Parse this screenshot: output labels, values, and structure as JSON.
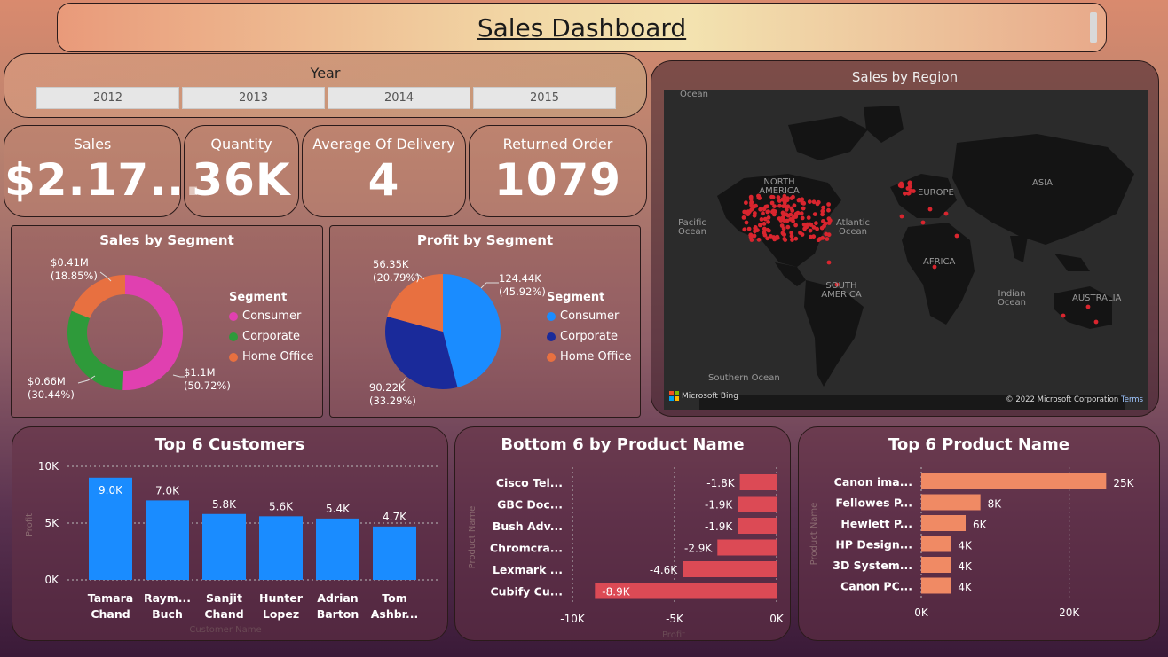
{
  "header": {
    "title": "Sales Dashboard"
  },
  "year_slicer": {
    "label": "Year",
    "options": [
      "2012",
      "2013",
      "2014",
      "2015"
    ]
  },
  "kpis": [
    {
      "label": "Sales",
      "value": "$2.17..."
    },
    {
      "label": "Quantity",
      "value": "36K"
    },
    {
      "label": "Average Of Delivery",
      "value": "4"
    },
    {
      "label": "Returned Order",
      "value": "1079"
    }
  ],
  "sales_by_segment": {
    "title": "Sales by Segment",
    "legend_title": "Segment",
    "legend": [
      "Consumer",
      "Corporate",
      "Home Office"
    ],
    "labels": {
      "home_office": [
        "$0.41M",
        "(18.85%)"
      ],
      "corporate": [
        "$0.66M",
        "(30.44%)"
      ],
      "consumer": [
        "$1.1M",
        "(50.72%)"
      ]
    }
  },
  "profit_by_segment": {
    "title": "Profit by Segment",
    "legend_title": "Segment",
    "legend": [
      "Consumer",
      "Corporate",
      "Home Office"
    ],
    "labels": {
      "home_office": [
        "56.35K",
        "(20.79%)"
      ],
      "consumer": [
        "124.44K",
        "(45.92%)"
      ],
      "corporate": [
        "90.22K",
        "(33.29%)"
      ]
    }
  },
  "map": {
    "title": "Sales by Region",
    "labels": [
      "Ocean",
      "NORTH AMERICA",
      "EUROPE",
      "ASIA",
      "Pacific Ocean",
      "Atlantic Ocean",
      "AFRICA",
      "SOUTH AMERICA",
      "Indian Ocean",
      "AUSTRALIA",
      "Southern Ocean"
    ],
    "bing": "Microsoft Bing",
    "copyright": "© 2022 Microsoft Corporation",
    "terms": "Terms"
  },
  "colors": {
    "consumer_sales": "#e040b0",
    "corporate_sales": "#2e9a3a",
    "home_office": "#e87040",
    "consumer_profit": "#1a8cff",
    "corporate_profit": "#1a2a9a",
    "bar_blue": "#1a8cff",
    "bar_red": "#dc4a55",
    "bar_orange": "#f08a64"
  },
  "chart_data": [
    {
      "type": "pie",
      "title": "Sales by Segment",
      "categories": [
        "Consumer",
        "Corporate",
        "Home Office"
      ],
      "values": [
        1.1,
        0.66,
        0.41
      ],
      "percent": [
        50.72,
        30.44,
        18.85
      ],
      "unit": "$M"
    },
    {
      "type": "pie",
      "title": "Profit by Segment",
      "categories": [
        "Consumer",
        "Corporate",
        "Home Office"
      ],
      "values": [
        124.44,
        90.22,
        56.35
      ],
      "percent": [
        45.92,
        33.29,
        20.79
      ],
      "unit": "K"
    },
    {
      "type": "bar",
      "title": "Top 6 Customers",
      "categories": [
        [
          "Tamara",
          "Chand"
        ],
        [
          "Raym...",
          "Buch"
        ],
        [
          "Sanjit",
          "Chand"
        ],
        [
          "Hunter",
          "Lopez"
        ],
        [
          "Adrian",
          "Barton"
        ],
        [
          "Tom",
          "Ashbr..."
        ]
      ],
      "values": [
        9.0,
        7.0,
        5.8,
        5.6,
        5.4,
        4.7
      ],
      "data_labels": [
        "9.0K",
        "7.0K",
        "5.8K",
        "5.6K",
        "5.4K",
        "4.7K"
      ],
      "yticks": [
        "10K",
        "5K",
        "0K"
      ],
      "ylim": [
        0,
        10
      ],
      "ylabel": "Profit",
      "xlabel": "Customer Name"
    },
    {
      "type": "bar",
      "title": "Bottom 6 by Product Name",
      "orientation": "horizontal",
      "categories": [
        "Cisco Tel...",
        "GBC Doc...",
        "Bush Adv...",
        "Chromcra...",
        "Lexmark ...",
        "Cubify Cu..."
      ],
      "values": [
        -1.8,
        -1.9,
        -1.9,
        -2.9,
        -4.6,
        -8.9
      ],
      "data_labels": [
        "-1.8K",
        "-1.9K",
        "-1.9K",
        "-2.9K",
        "-4.6K",
        "-8.9K"
      ],
      "xticks": [
        "-10K",
        "-5K",
        "0K"
      ],
      "xlim": [
        -10,
        0
      ],
      "xlabel": "Profit",
      "ylabel": "Product Name"
    },
    {
      "type": "bar",
      "title": "Top 6 Product Name",
      "orientation": "horizontal",
      "categories": [
        "Canon ima...",
        "Fellowes P...",
        "Hewlett P...",
        "HP Design...",
        "3D System...",
        "Canon PC..."
      ],
      "values": [
        25,
        8,
        6,
        4,
        4,
        4
      ],
      "data_labels": [
        "25K",
        "8K",
        "6K",
        "4K",
        "4K",
        "4K"
      ],
      "xticks": [
        "0K",
        "20K"
      ],
      "xlim": [
        0,
        30
      ],
      "ylabel": "Product Name"
    }
  ]
}
